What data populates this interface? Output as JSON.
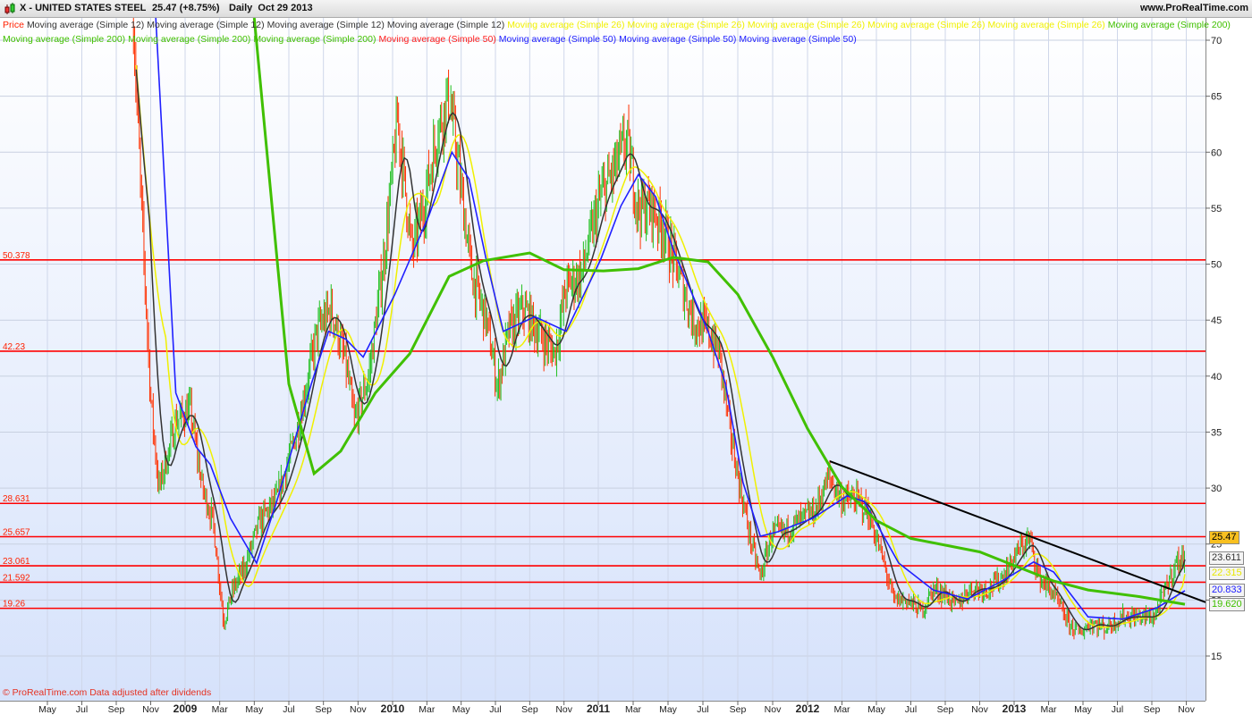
{
  "header": {
    "symbol_title": "X - UNITED STATES STEEL",
    "price_change": "25.47 (+8.75%)",
    "period_date": "Daily  Oct 29 2013",
    "site": "www.ProRealTime.com"
  },
  "legend": {
    "row1": [
      {
        "label": "Price",
        "color": "#ff2000"
      },
      {
        "label": "Moving average (Simple 12)",
        "color": "#333333"
      },
      {
        "label": "Moving average (Simple 12)",
        "color": "#333333"
      },
      {
        "label": "Moving average (Simple 12)",
        "color": "#333333"
      },
      {
        "label": "Moving average (Simple 12)",
        "color": "#333333"
      },
      {
        "label": "Moving average (Simple 26)",
        "color": "#f0f000"
      },
      {
        "label": "Moving average (Simple 26)",
        "color": "#f0f000"
      },
      {
        "label": "Moving average (Simple 26)",
        "color": "#f0f000"
      },
      {
        "label": "Moving average (Simple 26)",
        "color": "#f0f000"
      },
      {
        "label": "Moving average (Simple 26)",
        "color": "#f0f000"
      },
      {
        "label": "Moving average (Simple 200)",
        "color": "#40c000"
      }
    ],
    "row2": [
      {
        "label": "Moving average (Simple 200)",
        "color": "#40c000"
      },
      {
        "label": "Moving average (Simple 200)",
        "color": "#40c000"
      },
      {
        "label": "Moving average (Simple 200)",
        "color": "#40c000"
      },
      {
        "label": "Moving average (Simple 50)",
        "color": "#ff2020"
      },
      {
        "label": "Moving average (Simple 50)",
        "color": "#2020ff"
      },
      {
        "label": "Moving average (Simple 50)",
        "color": "#2020ff"
      },
      {
        "label": "Moving average (Simple 50)",
        "color": "#2020ff"
      }
    ]
  },
  "footer": {
    "copyright": "© ProRealTime.com Data adjusted after dividends"
  },
  "badges": [
    {
      "value": "25.47",
      "color": "#000000",
      "bg": "#f8c020"
    },
    {
      "value": "23.611",
      "color": "#333333",
      "bg": "#f4f4f4"
    },
    {
      "value": "22.315",
      "color": "#e8e800",
      "bg": "#f4f4f4"
    },
    {
      "value": "20.833",
      "color": "#2020ff",
      "bg": "#f4f4f4"
    },
    {
      "value": "19.620",
      "color": "#40c000",
      "bg": "#f4f4f4"
    }
  ],
  "chart_data": {
    "type": "line",
    "title": "X - UNITED STATES STEEL",
    "ylim": [
      12,
      72
    ],
    "y_ticks": [
      15,
      20,
      25,
      30,
      35,
      40,
      45,
      50,
      55,
      60,
      65,
      70
    ],
    "x_ticks": [
      {
        "date": "2008-05",
        "label": "May"
      },
      {
        "date": "2008-07",
        "label": "Jul"
      },
      {
        "date": "2008-09",
        "label": "Sep"
      },
      {
        "date": "2008-11",
        "label": "Nov"
      },
      {
        "date": "2009-01",
        "label": "2009",
        "bold": true
      },
      {
        "date": "2009-03",
        "label": "Mar"
      },
      {
        "date": "2009-05",
        "label": "May"
      },
      {
        "date": "2009-07",
        "label": "Jul"
      },
      {
        "date": "2009-09",
        "label": "Sep"
      },
      {
        "date": "2009-11",
        "label": "Nov"
      },
      {
        "date": "2010-01",
        "label": "2010",
        "bold": true
      },
      {
        "date": "2010-03",
        "label": "Mar"
      },
      {
        "date": "2010-05",
        "label": "May"
      },
      {
        "date": "2010-07",
        "label": "Jul"
      },
      {
        "date": "2010-09",
        "label": "Sep"
      },
      {
        "date": "2010-11",
        "label": "Nov"
      },
      {
        "date": "2011-01",
        "label": "2011",
        "bold": true
      },
      {
        "date": "2011-03",
        "label": "Mar"
      },
      {
        "date": "2011-05",
        "label": "May"
      },
      {
        "date": "2011-07",
        "label": "Jul"
      },
      {
        "date": "2011-09",
        "label": "Sep"
      },
      {
        "date": "2011-11",
        "label": "Nov"
      },
      {
        "date": "2012-01",
        "label": "2012",
        "bold": true
      },
      {
        "date": "2012-03",
        "label": "Mar"
      },
      {
        "date": "2012-05",
        "label": "May"
      },
      {
        "date": "2012-07",
        "label": "Jul"
      },
      {
        "date": "2012-09",
        "label": "Sep"
      },
      {
        "date": "2012-11",
        "label": "Nov"
      },
      {
        "date": "2013-01",
        "label": "2013",
        "bold": true
      },
      {
        "date": "2013-03",
        "label": "Mar"
      },
      {
        "date": "2013-05",
        "label": "May"
      },
      {
        "date": "2013-07",
        "label": "Jul"
      },
      {
        "date": "2013-09",
        "label": "Sep"
      },
      {
        "date": "2013-11",
        "label": "Nov"
      }
    ],
    "horizontal_levels": [
      50.378,
      42.23,
      28.631,
      25.657,
      23.061,
      21.592,
      19.26
    ],
    "level_color": "#ff0000",
    "trendline": {
      "from": [
        "2012-02-10",
        32.4
      ],
      "to": [
        "2013-10-29",
        19.8
      ],
      "color": "#000000"
    },
    "series": [
      {
        "name": "Price",
        "color_up": "#20c020",
        "color_down": "#ff3000",
        "points": [
          [
            "2008-10-01",
            72
          ],
          [
            "2008-10-15",
            55
          ],
          [
            "2008-11-01",
            38
          ],
          [
            "2008-11-15",
            30
          ],
          [
            "2008-12-01",
            33
          ],
          [
            "2008-12-15",
            36
          ],
          [
            "2009-01-10",
            37
          ],
          [
            "2009-02-01",
            30
          ],
          [
            "2009-02-20",
            27
          ],
          [
            "2009-03-08",
            18
          ],
          [
            "2009-03-25",
            21
          ],
          [
            "2009-04-15",
            23
          ],
          [
            "2009-05-10",
            27
          ],
          [
            "2009-06-10",
            29
          ],
          [
            "2009-07-10",
            34
          ],
          [
            "2009-08-01",
            39
          ],
          [
            "2009-08-20",
            44
          ],
          [
            "2009-09-15",
            46
          ],
          [
            "2009-10-10",
            41
          ],
          [
            "2009-10-25",
            36
          ],
          [
            "2009-11-20",
            40
          ],
          [
            "2009-12-15",
            50
          ],
          [
            "2010-01-10",
            63
          ],
          [
            "2010-02-05",
            51
          ],
          [
            "2010-02-25",
            55
          ],
          [
            "2010-03-20",
            62
          ],
          [
            "2010-04-10",
            65
          ],
          [
            "2010-04-28",
            58
          ],
          [
            "2010-05-20",
            49
          ],
          [
            "2010-06-15",
            45
          ],
          [
            "2010-07-05",
            39
          ],
          [
            "2010-07-25",
            44
          ],
          [
            "2010-08-20",
            46
          ],
          [
            "2010-09-15",
            44
          ],
          [
            "2010-10-15",
            42
          ],
          [
            "2010-11-05",
            48
          ],
          [
            "2010-12-01",
            49
          ],
          [
            "2011-01-05",
            56
          ],
          [
            "2011-01-25",
            58
          ],
          [
            "2011-02-20",
            61
          ],
          [
            "2011-03-10",
            55
          ],
          [
            "2011-04-05",
            55
          ],
          [
            "2011-04-25",
            53
          ],
          [
            "2011-05-20",
            49
          ],
          [
            "2011-06-15",
            45
          ],
          [
            "2011-07-10",
            44
          ],
          [
            "2011-07-30",
            42
          ],
          [
            "2011-08-15",
            36
          ],
          [
            "2011-09-05",
            30
          ],
          [
            "2011-09-25",
            25
          ],
          [
            "2011-10-10",
            22
          ],
          [
            "2011-10-30",
            26
          ],
          [
            "2011-11-20",
            26
          ],
          [
            "2011-12-15",
            27
          ],
          [
            "2012-01-15",
            28
          ],
          [
            "2012-02-08",
            31
          ],
          [
            "2012-03-01",
            29
          ],
          [
            "2012-03-25",
            29
          ],
          [
            "2012-04-15",
            28
          ],
          [
            "2012-05-10",
            24
          ],
          [
            "2012-06-01",
            20
          ],
          [
            "2012-06-25",
            20
          ],
          [
            "2012-07-20",
            19
          ],
          [
            "2012-08-10",
            21
          ],
          [
            "2012-09-01",
            20.5
          ],
          [
            "2012-09-20",
            19.5
          ],
          [
            "2012-10-15",
            21
          ],
          [
            "2012-11-15",
            21
          ],
          [
            "2012-12-10",
            22
          ],
          [
            "2013-01-10",
            24.5
          ],
          [
            "2013-01-28",
            25.5
          ],
          [
            "2013-02-15",
            22
          ],
          [
            "2013-03-10",
            20.5
          ],
          [
            "2013-04-05",
            18
          ],
          [
            "2013-04-25",
            17
          ],
          [
            "2013-05-15",
            18
          ],
          [
            "2013-06-10",
            17.5
          ],
          [
            "2013-07-10",
            18.5
          ],
          [
            "2013-08-10",
            18.5
          ],
          [
            "2013-09-05",
            18.5
          ],
          [
            "2013-09-25",
            21
          ],
          [
            "2013-10-15",
            23.5
          ],
          [
            "2013-10-25",
            23.4
          ],
          [
            "2013-10-29",
            25.47
          ]
        ]
      },
      {
        "name": "Moving average (Simple 12)",
        "color": "#333333",
        "last": 23.611
      },
      {
        "name": "Moving average (Simple 26)",
        "color": "#f0f000",
        "last": 22.315
      },
      {
        "name": "Moving average (Simple 50)",
        "color": "#2020ff",
        "last": 20.833,
        "points": [
          [
            "2008-11-10",
            72
          ],
          [
            "2008-12-15",
            38.5
          ],
          [
            "2009-01-20",
            33.7
          ],
          [
            "2009-02-15",
            32.1
          ],
          [
            "2009-03-20",
            27.3
          ],
          [
            "2009-05-05",
            23.3
          ],
          [
            "2009-06-10",
            28.8
          ],
          [
            "2009-08-10",
            39.3
          ],
          [
            "2009-09-10",
            44
          ],
          [
            "2009-10-10",
            43.3
          ],
          [
            "2009-11-10",
            41.7
          ],
          [
            "2010-01-05",
            47.3
          ],
          [
            "2010-03-05",
            54.4
          ],
          [
            "2010-04-15",
            60
          ],
          [
            "2010-05-15",
            57.6
          ],
          [
            "2010-06-15",
            50.4
          ],
          [
            "2010-07-15",
            44
          ],
          [
            "2010-09-10",
            45.3
          ],
          [
            "2010-11-05",
            44
          ],
          [
            "2011-01-05",
            50.4
          ],
          [
            "2011-02-10",
            55.2
          ],
          [
            "2011-03-10",
            58
          ],
          [
            "2011-04-10",
            56
          ],
          [
            "2011-05-10",
            51.3
          ],
          [
            "2011-07-10",
            44
          ],
          [
            "2011-08-10",
            39.3
          ],
          [
            "2011-09-10",
            30.5
          ],
          [
            "2011-10-10",
            25.7
          ],
          [
            "2011-11-10",
            26.1
          ],
          [
            "2012-01-10",
            27.3
          ],
          [
            "2012-03-10",
            29.3
          ],
          [
            "2012-04-10",
            28.8
          ],
          [
            "2012-06-10",
            23.3
          ],
          [
            "2012-08-10",
            20.9
          ],
          [
            "2012-10-10",
            20.1
          ],
          [
            "2012-12-10",
            21.7
          ],
          [
            "2013-02-05",
            23.4
          ],
          [
            "2013-03-10",
            22.5
          ],
          [
            "2013-05-10",
            18.5
          ],
          [
            "2013-07-10",
            18.3
          ],
          [
            "2013-09-10",
            19.3
          ],
          [
            "2013-10-29",
            20.833
          ]
        ]
      },
      {
        "name": "Moving average (Simple 200)",
        "color": "#40c000",
        "last": 19.62,
        "points": [
          [
            "2009-05-01",
            72
          ],
          [
            "2009-07-01",
            39.3
          ],
          [
            "2009-08-15",
            31.3
          ],
          [
            "2009-10-01",
            33.3
          ],
          [
            "2009-12-01",
            38.5
          ],
          [
            "2010-02-01",
            42
          ],
          [
            "2010-04-10",
            48.9
          ],
          [
            "2010-06-10",
            50.3
          ],
          [
            "2010-09-01",
            51
          ],
          [
            "2010-11-01",
            49.5
          ],
          [
            "2011-01-10",
            49.4
          ],
          [
            "2011-03-10",
            49.6
          ],
          [
            "2011-05-10",
            50.6
          ],
          [
            "2011-07-10",
            50.2
          ],
          [
            "2011-09-01",
            47.3
          ],
          [
            "2011-11-01",
            41.7
          ],
          [
            "2012-01-01",
            35.3
          ],
          [
            "2012-03-01",
            30.1
          ],
          [
            "2012-05-01",
            27.1
          ],
          [
            "2012-07-01",
            25.5
          ],
          [
            "2012-11-01",
            24.3
          ],
          [
            "2013-01-10",
            22.9
          ],
          [
            "2013-03-10",
            21.7
          ],
          [
            "2013-05-10",
            20.9
          ],
          [
            "2013-08-10",
            20.3
          ],
          [
            "2013-10-29",
            19.62
          ]
        ]
      }
    ]
  }
}
